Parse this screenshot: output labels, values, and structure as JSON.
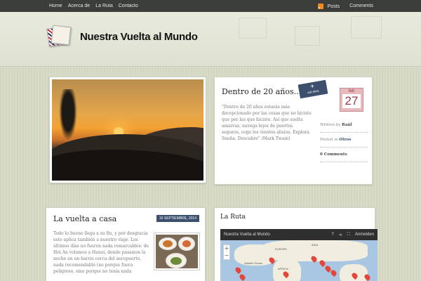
{
  "nav": {
    "items": [
      "Home",
      "Acerca de",
      "La Ruta",
      "Contacto"
    ]
  },
  "feeds": {
    "posts": "Posts",
    "comments": "Comments"
  },
  "site": {
    "title": "Nuestra Vuelta al Mundo"
  },
  "featured": {
    "title": "Dentro de 20 años...",
    "excerpt": "\"Dentro de 20 años estarás más decepcionado por las cosas que no hiciste que por las que hiciste. Así que suelta amarras, navega lejos de puertos seguros, coge los vientos alisios. Explora. Sueña. Descubre\" (Mark Twain)",
    "written_by_label": "Written by",
    "author": "Raúl",
    "posted_in_label": "Posted in",
    "category": "Otros",
    "comments": "0 Comments",
    "date_month": "feb",
    "date_day": "27",
    "airmail": "AIR MAIL"
  },
  "post2": {
    "title": "La vuelta a casa",
    "date": "16 SEPTIEMBRE, 2014",
    "excerpt": "Todo lo bueno llega a su fin, y por desgracia esto aplica también a nuestro viaje. Los últimos días no fueron nada remarcables: de Hoi An volamos a Hanoi, donde pasamos la noche en un barrio cerca del aeropuerto, nada recomendable (no porque fuera peligroso, sino porque no tenía nada"
  },
  "route": {
    "title": "La Ruta",
    "map_title": "Nuestra Vuelta al Mundo",
    "map_action": "Anmelden",
    "labels": [
      "EUROPE",
      "ASIA",
      "AFRICA",
      "Atlantic Ocean"
    ]
  }
}
